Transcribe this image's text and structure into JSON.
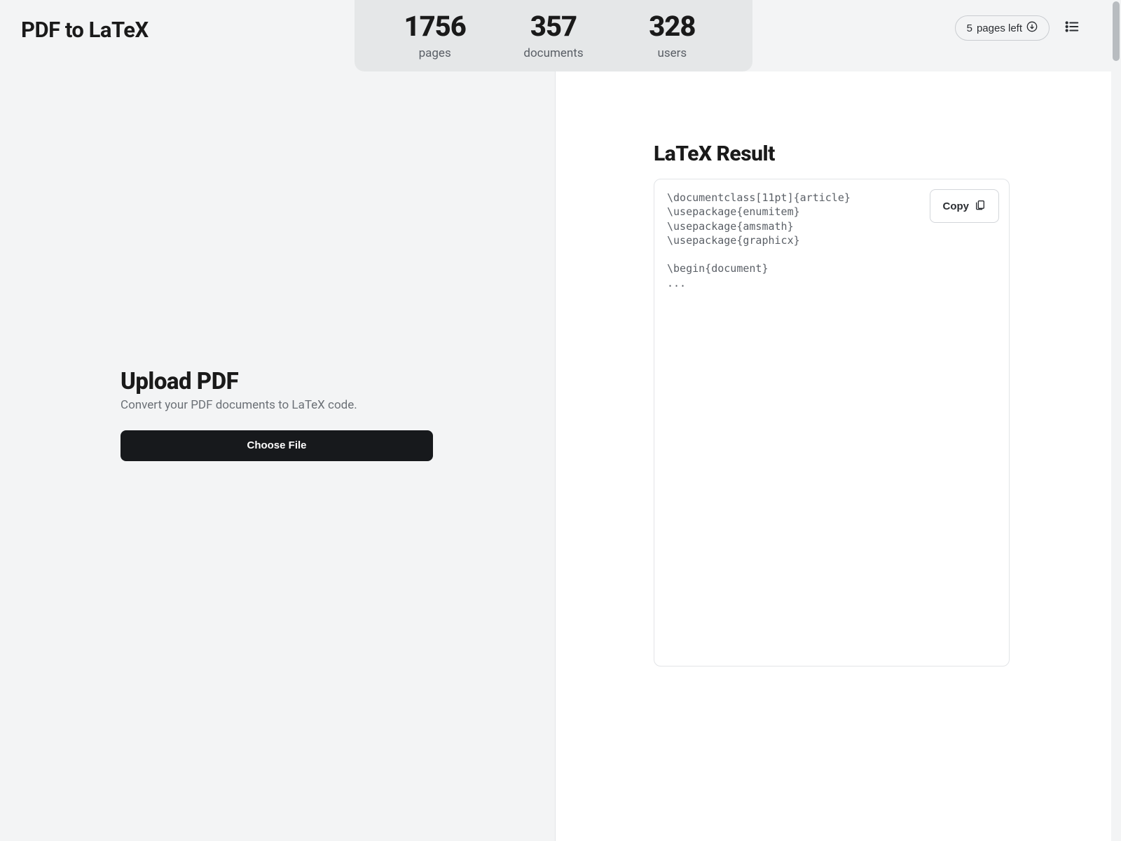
{
  "app": {
    "title": "PDF to LaTeX"
  },
  "stats": {
    "pages": {
      "value": "1756",
      "label": "pages"
    },
    "documents": {
      "value": "357",
      "label": "documents"
    },
    "users": {
      "value": "328",
      "label": "users"
    }
  },
  "header": {
    "pages_left_count": "5",
    "pages_left_label": "pages left"
  },
  "upload": {
    "heading": "Upload PDF",
    "subtitle": "Convert your PDF documents to LaTeX code.",
    "button_label": "Choose File"
  },
  "result": {
    "heading": "LaTeX Result",
    "copy_label": "Copy",
    "code": "\\documentclass[11pt]{article}\n\\usepackage{enumitem}\n\\usepackage{amsmath}\n\\usepackage{graphicx}\n\n\\begin{document}\n..."
  }
}
